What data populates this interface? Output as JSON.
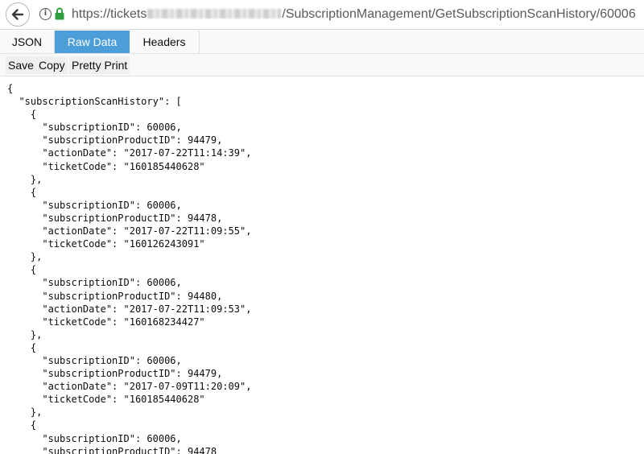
{
  "browser": {
    "url_prefix": "https://tickets",
    "url_suffix": "/SubscriptionManagement/GetSubscriptionScanHistory/60006",
    "info_glyph": "i",
    "back_icon": "back-arrow-icon",
    "lock_color": "#2e9e3f"
  },
  "viewer": {
    "tabs": [
      {
        "label": "JSON"
      },
      {
        "label": "Raw Data",
        "active": true
      },
      {
        "label": "Headers"
      }
    ],
    "toolbar": {
      "save": "Save",
      "copy": "Copy",
      "pretty_print": "Pretty Print"
    },
    "accent_color": "#4c9ed9"
  },
  "raw_json": "{\n  \"subscriptionScanHistory\": [\n    {\n      \"subscriptionID\": 60006,\n      \"subscriptionProductID\": 94479,\n      \"actionDate\": \"2017-07-22T11:14:39\",\n      \"ticketCode\": \"160185440628\"\n    },\n    {\n      \"subscriptionID\": 60006,\n      \"subscriptionProductID\": 94478,\n      \"actionDate\": \"2017-07-22T11:09:55\",\n      \"ticketCode\": \"160126243091\"\n    },\n    {\n      \"subscriptionID\": 60006,\n      \"subscriptionProductID\": 94480,\n      \"actionDate\": \"2017-07-22T11:09:53\",\n      \"ticketCode\": \"160168234427\"\n    },\n    {\n      \"subscriptionID\": 60006,\n      \"subscriptionProductID\": 94479,\n      \"actionDate\": \"2017-07-09T11:20:09\",\n      \"ticketCode\": \"160185440628\"\n    },\n    {\n      \"subscriptionID\": 60006,\n      \"subscriptionProductID\": 94478"
}
